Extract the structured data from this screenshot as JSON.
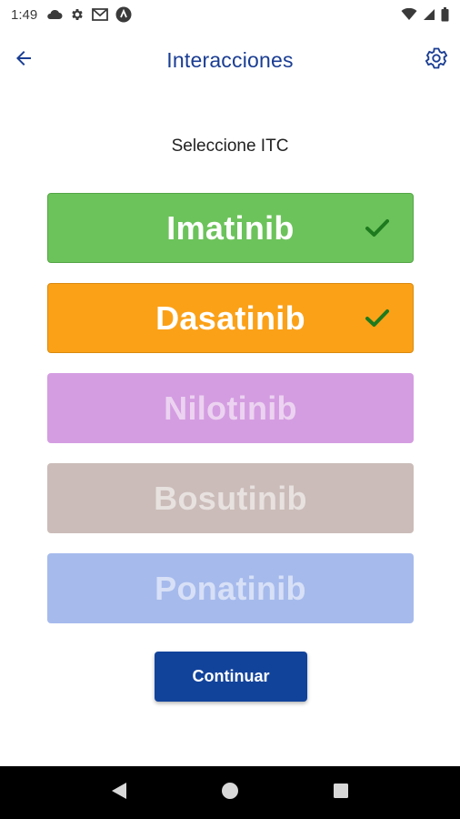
{
  "status_bar": {
    "time": "1:49",
    "left_icons": [
      "cloud-icon",
      "settings-small-icon",
      "gmail-icon",
      "app-circle-icon"
    ],
    "right_icons": [
      "wifi-icon",
      "signal-icon",
      "battery-icon"
    ]
  },
  "app_bar": {
    "title": "Interacciones",
    "back_icon": "arrow-back-icon",
    "settings_icon": "gear-icon"
  },
  "prompt": "Seleccione ITC",
  "drugs": [
    {
      "label": "Imatinib",
      "selected": true,
      "color": "#6cc35b"
    },
    {
      "label": "Dasatinib",
      "selected": true,
      "color": "#fba118"
    },
    {
      "label": "Nilotinib",
      "selected": false,
      "color": "#d49de1"
    },
    {
      "label": "Bosutinib",
      "selected": false,
      "color": "#cbbcb9"
    },
    {
      "label": "Ponatinib",
      "selected": false,
      "color": "#a6baec"
    }
  ],
  "continue_label": "Continuar",
  "colors": {
    "accent": "#1a3d93",
    "continue_button": "#12439b",
    "check": "#1e7a1e"
  },
  "nav_bar": [
    "nav-back-icon",
    "nav-home-icon",
    "nav-recents-icon"
  ]
}
